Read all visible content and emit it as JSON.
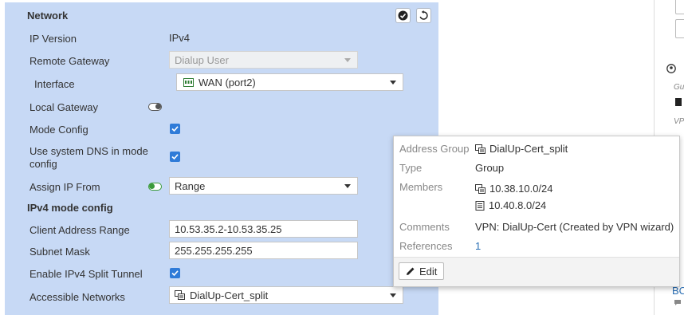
{
  "section": {
    "title": "Network"
  },
  "fields": {
    "ip_version": {
      "label": "IP Version",
      "value": "IPv4"
    },
    "remote_gateway": {
      "label": "Remote Gateway",
      "value": "Dialup User"
    },
    "interface": {
      "label": "Interface",
      "value": "WAN (port2)"
    },
    "local_gateway": {
      "label": "Local Gateway",
      "enabled": false
    },
    "mode_config": {
      "label": "Mode Config",
      "checked": true
    },
    "use_system_dns": {
      "label_line1": "Use system DNS in mode",
      "label_line2": "config",
      "checked": true
    },
    "assign_ip_from": {
      "label": "Assign IP From",
      "enabled": true,
      "value": "Range"
    }
  },
  "ipv4_mode": {
    "title": "IPv4 mode config",
    "client_address_range": {
      "label": "Client Address Range",
      "value": "10.53.35.2-10.53.35.25"
    },
    "subnet_mask": {
      "label": "Subnet Mask",
      "value": "255.255.255.255"
    },
    "split_tunnel": {
      "label": "Enable IPv4 Split Tunnel",
      "checked": true
    },
    "accessible_networks": {
      "label": "Accessible Networks",
      "value": "DialUp-Cert_split"
    }
  },
  "tooltip": {
    "address_group_key": "Address Group",
    "address_group_value": "DialUp-Cert_split",
    "type_key": "Type",
    "type_value": "Group",
    "members_key": "Members",
    "members": [
      "10.38.10.0/24",
      "10.40.8.0/24"
    ],
    "comments_key": "Comments",
    "comments_value": "VPN: DialUp-Cert (Created by VPN wizard)",
    "references_key": "References",
    "references_value": "1",
    "edit_label": "Edit"
  },
  "right_panel": {
    "text_gu": "Gu",
    "text_vp": "VP",
    "text_bc": "BC"
  },
  "colors": {
    "panel_bg": "#c7d9f5",
    "checkbox": "#2f7bd8",
    "toggle_on": "#3a9a3a",
    "link": "#2a6fb5"
  }
}
